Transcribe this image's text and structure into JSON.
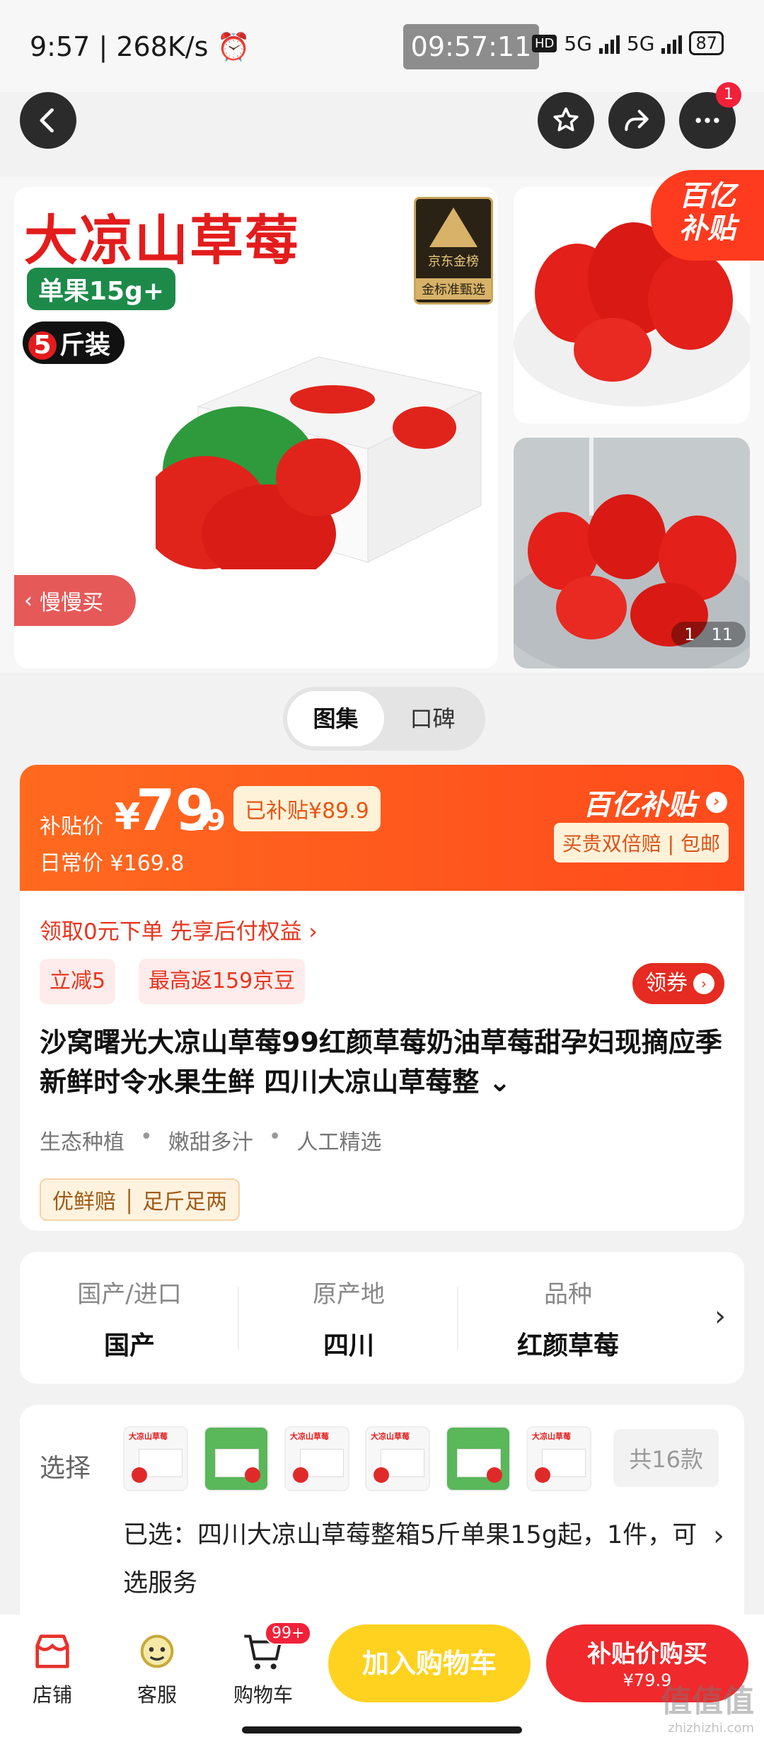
{
  "status_bar": {
    "time": "9:57",
    "speed": "268K/s",
    "clock": "09:57:11",
    "net1": "5G",
    "net2": "5G",
    "battery": "87"
  },
  "top_actions": {
    "more_badge": "1"
  },
  "gallery": {
    "title": "大凉山草莓",
    "weight_tag": "单果15g+",
    "jin_num": "5",
    "jin_text": "斤装",
    "gold_brand": "京东金榜",
    "gold_tag": "金标准甄选",
    "subsidy_corner_1": "百亿",
    "subsidy_corner_2": "补贴",
    "slow_buy": "慢慢买",
    "counter_current": "1",
    "counter_total": "11"
  },
  "tabs": [
    "图集",
    "口碑"
  ],
  "price": {
    "label": "补贴价",
    "yen": "¥",
    "integer": "79",
    "decimal": ".9",
    "saved": "已补贴¥89.9",
    "daily": "日常价 ¥169.8",
    "brand": "百亿补贴",
    "brand_tags": "买贵双倍赔 | 包邮"
  },
  "info": {
    "coupon_line": "领取0元下单 先享后付权益 ›",
    "tag1": "立减5",
    "tag2": "最高返159京豆",
    "coupon_btn": "领券",
    "title": "沙窝曙光大凉山草莓99红颜草莓奶油草莓甜孕妇现摘应季新鲜时令水果生鲜 四川大凉山草莓整 ⌄",
    "features": [
      "生态种植",
      "嫩甜多汁",
      "人工精选"
    ],
    "assure": "优鲜赔 │ 足斤足两"
  },
  "attributes": [
    {
      "key": "国产/进口",
      "value": "国产"
    },
    {
      "key": "原产地",
      "value": "四川"
    },
    {
      "key": "品种",
      "value": "红颜草莓"
    }
  ],
  "select": {
    "label": "选择",
    "count": "共16款",
    "selected": "已选：四川大凉山草莓整箱5斤单果15g起，1件，可选服务"
  },
  "bottom": {
    "shop": "店铺",
    "service": "客服",
    "cart": "购物车",
    "cart_badge": "99+",
    "add_cart": "加入购物车",
    "buy_main": "补贴价购买",
    "buy_price": "¥79.9"
  },
  "watermark": {
    "main": "值值值",
    "sub": "zhizhizhi.com"
  },
  "colors": {
    "accent": "#ff5a1f",
    "red": "#e52b22",
    "yellow": "#ffd21f"
  }
}
